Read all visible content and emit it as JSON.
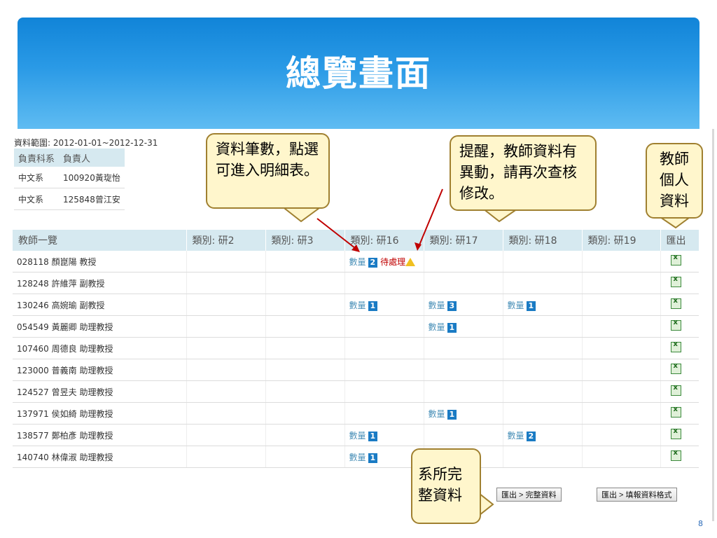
{
  "slide_title": "總覽畫面",
  "data_range": "資料範圍: 2012-01-01~2012-12-31",
  "responsibility": {
    "headers": [
      "負責科系",
      "負責人"
    ],
    "rows": [
      [
        "中文系",
        "100920黃琁怡"
      ],
      [
        "中文系",
        "125848曾江安"
      ]
    ]
  },
  "teacher_table": {
    "headers": [
      "教師一覽",
      "類別: 研2",
      "類別: 研3",
      "類別: 研16",
      "類別: 研17",
      "類別: 研18",
      "類別: 研19",
      "匯出"
    ],
    "count_label": "數量",
    "pending_label": "待處理",
    "rows": [
      {
        "teacher": "028118 顏崑陽 教授",
        "cells": [
          null,
          null,
          {
            "count": "2",
            "pending": true
          },
          null,
          null,
          null
        ]
      },
      {
        "teacher": "128248 許維萍 副教授",
        "cells": [
          null,
          null,
          null,
          null,
          null,
          null
        ]
      },
      {
        "teacher": "130246 高婉瑜 副教授",
        "cells": [
          null,
          null,
          {
            "count": "1"
          },
          {
            "count": "3"
          },
          {
            "count": "1"
          },
          null
        ]
      },
      {
        "teacher": "054549 黃麗卿 助理教授",
        "cells": [
          null,
          null,
          null,
          {
            "count": "1"
          },
          null,
          null
        ]
      },
      {
        "teacher": "107460 周德良 助理教授",
        "cells": [
          null,
          null,
          null,
          null,
          null,
          null
        ]
      },
      {
        "teacher": "123000 普義南 助理教授",
        "cells": [
          null,
          null,
          null,
          null,
          null,
          null
        ]
      },
      {
        "teacher": "124527 曾昱夫 助理教授",
        "cells": [
          null,
          null,
          null,
          null,
          null,
          null
        ]
      },
      {
        "teacher": "137971 侯如綺 助理教授",
        "cells": [
          null,
          null,
          null,
          {
            "count": "1"
          },
          null,
          null
        ]
      },
      {
        "teacher": "138577 鄭柏彥 助理教授",
        "cells": [
          null,
          null,
          {
            "count": "1"
          },
          null,
          {
            "count": "2"
          },
          null
        ]
      },
      {
        "teacher": "140740 林偉淑 助理教授",
        "cells": [
          null,
          null,
          {
            "count": "1"
          },
          null,
          null,
          null
        ]
      }
    ]
  },
  "buttons": {
    "export_full": "匯出 > 完整資料",
    "export_format": "匯出 > 填報資料格式"
  },
  "callouts": {
    "count_note": "資料筆數，點選可進入明細表。",
    "reminder_note": "提醒，教師資料有異動，請再次查核修改。",
    "personal_note": "教師個人資料",
    "dept_note": "系所完整資料"
  },
  "page_number": "8",
  "colors": {
    "header_blue": "#1184d8",
    "table_header": "#d6e9f0",
    "badge": "#1a7bc4",
    "pending_red": "#c00000",
    "callout_fill": "#fff6cc"
  }
}
